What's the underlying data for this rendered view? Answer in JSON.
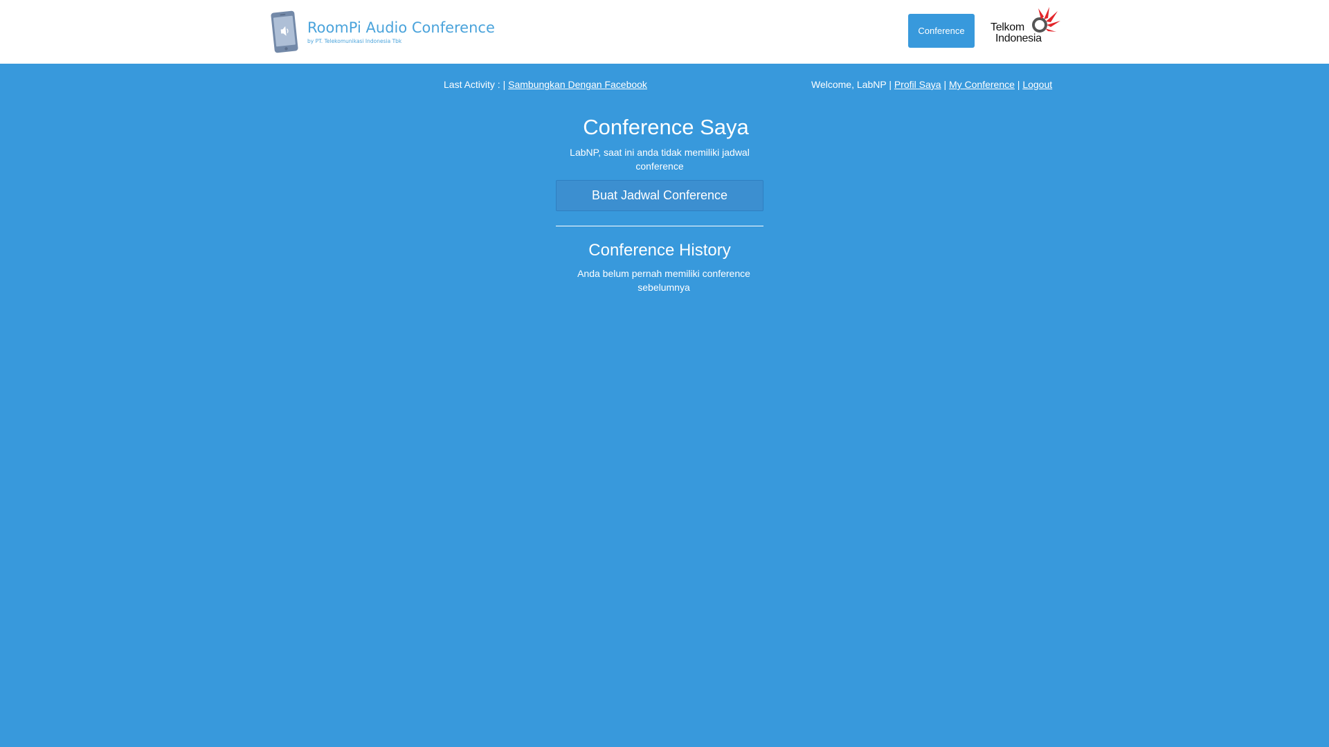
{
  "header": {
    "app_title": "RoomPi Audio Conference",
    "app_subtitle": "by PT. Telekomunikasi Indonesia Tbk",
    "nav_button": "Conference",
    "brand_logo_line1": "Telkom",
    "brand_logo_line2": "Indonesia",
    "logo_icon": "phone-speaker-icon",
    "brand_icon": "telkom-logo-icon"
  },
  "topbar": {
    "last_activity_label": "Last Activity : |",
    "facebook_link": "Sambungkan Dengan Facebook",
    "welcome_text": "Welcome, LabNP |",
    "profile_link": "Profil Saya",
    "sep1": "|",
    "my_conference_link": "My Conference",
    "sep2": "|",
    "logout_link": "Logout"
  },
  "main": {
    "title": "Conference Saya",
    "message": "LabNP, saat ini anda tidak memiliki jadwal conference",
    "create_button": "Buat Jadwal Conference",
    "history_title": "Conference History",
    "history_message": "Anda belum pernah memiliki conference sebelumnya"
  },
  "colors": {
    "background": "#3899dc",
    "header_bg": "#ffffff",
    "accent": "#3899dc",
    "logo_text": "#4aa3db",
    "telkom_red": "#e3262b"
  }
}
